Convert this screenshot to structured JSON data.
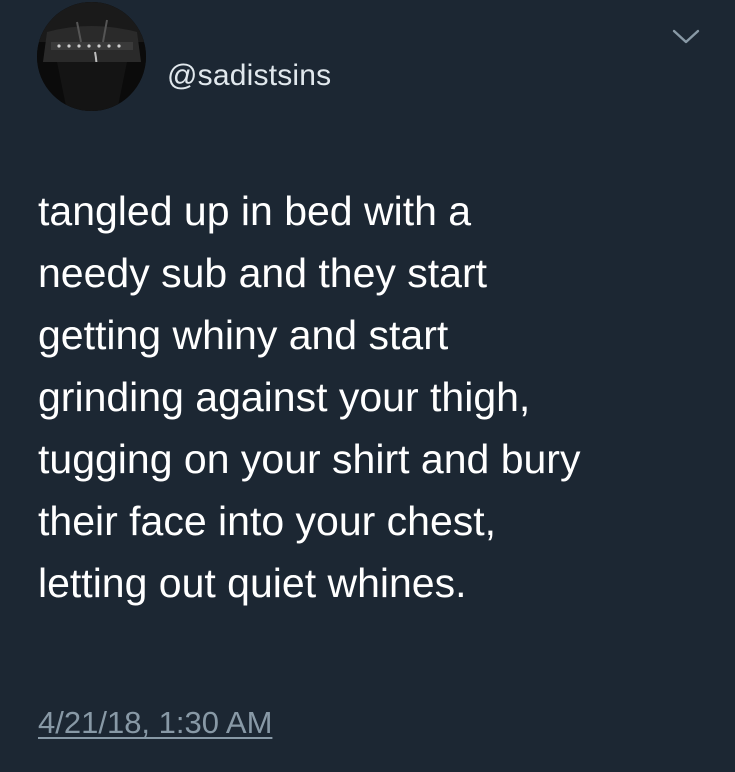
{
  "tweet": {
    "handle": "@sadistsins",
    "body_lines": [
      "tangled up in bed with a",
      "needy sub and they start",
      "getting whiny and start",
      "grinding against your thigh,",
      "tugging on your shirt and bury",
      "their face into your chest,",
      "letting out quiet whines."
    ],
    "timestamp": "4/21/18, 1:30 AM",
    "avatar_icon": "avatar-photo",
    "menu_icon": "chevron-down-icon"
  },
  "colors": {
    "background": "#1c2733",
    "text_primary": "#ffffff",
    "text_secondary": "#8899a6"
  }
}
